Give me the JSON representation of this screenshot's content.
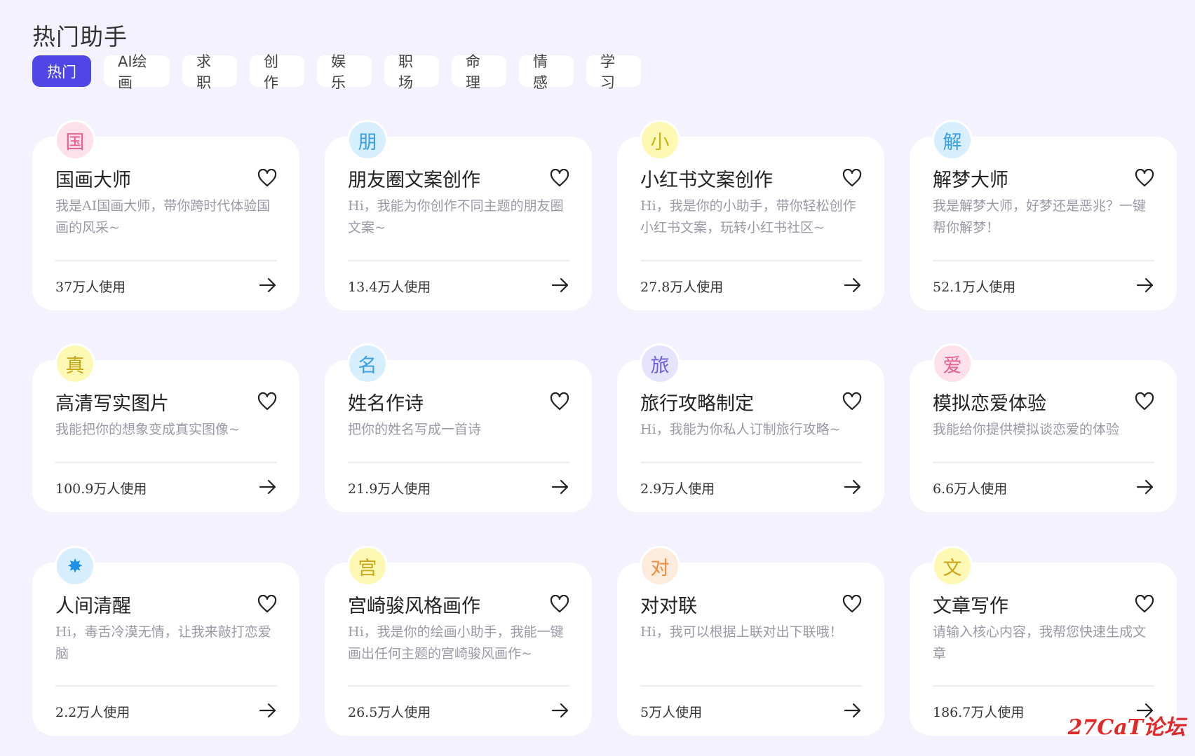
{
  "page_title": "热门助手",
  "tabs": [
    {
      "label": "热门",
      "active": true
    },
    {
      "label": "AI绘画"
    },
    {
      "label": "求职"
    },
    {
      "label": "创作"
    },
    {
      "label": "娱乐"
    },
    {
      "label": "职场"
    },
    {
      "label": "命理"
    },
    {
      "label": "情感"
    },
    {
      "label": "学习"
    }
  ],
  "assistants": [
    {
      "avatar": "国",
      "avatar_bg": "#fde0ea",
      "avatar_color": "#e75f8a",
      "title": "国画大师",
      "desc": "我是AI国画大师，带你跨时代体验国画的风采~",
      "usage": "37万人使用"
    },
    {
      "avatar": "朋",
      "avatar_bg": "#d7eefe",
      "avatar_color": "#3b9fe0",
      "title": "朋友圈文案创作",
      "desc": "Hi，我能为你创作不同主题的朋友圈文案~",
      "usage": "13.4万人使用"
    },
    {
      "avatar": "小",
      "avatar_bg": "#fdf8b4",
      "avatar_color": "#c9b21a",
      "title": "小红书文案创作",
      "desc": "Hi，我是你的小助手，带你轻松创作小红书文案，玩转小红书社区~",
      "usage": "27.8万人使用"
    },
    {
      "avatar": "解",
      "avatar_bg": "#d7eefe",
      "avatar_color": "#3b9fe0",
      "title": "解梦大师",
      "desc": "我是解梦大师，好梦还是恶兆？一键帮你解梦！",
      "usage": "52.1万人使用"
    },
    {
      "avatar": "真",
      "avatar_bg": "#fdf8b4",
      "avatar_color": "#c9a51a",
      "title": "高清写实图片",
      "desc": "我能把你的想象变成真实图像~",
      "usage": "100.9万人使用"
    },
    {
      "avatar": "名",
      "avatar_bg": "#d7eefe",
      "avatar_color": "#3b9fe0",
      "title": "姓名作诗",
      "desc": "把你的姓名写成一首诗",
      "usage": "21.9万人使用"
    },
    {
      "avatar": "旅",
      "avatar_bg": "#e6e4fd",
      "avatar_color": "#6b5fe0",
      "title": "旅行攻略制定",
      "desc": "Hi，我能为你私人订制旅行攻略~",
      "usage": "2.9万人使用"
    },
    {
      "avatar": "爱",
      "avatar_bg": "#fde0ea",
      "avatar_color": "#e75f8a",
      "title": "模拟恋爱体验",
      "desc": "我能给你提供模拟谈恋爱的体验",
      "usage": "6.6万人使用"
    },
    {
      "avatar": "✸",
      "avatar_bg": "#d7eefe",
      "avatar_color": "#1e90e8",
      "title": "人间清醒",
      "desc": "Hi，毒舌冷漠无情，让我来敲打恋爱脑",
      "usage": "2.2万人使用"
    },
    {
      "avatar": "宫",
      "avatar_bg": "#fdf8b4",
      "avatar_color": "#c9a51a",
      "title": "宫崎骏风格画作",
      "desc": "Hi，我是你的绘画小助手，我能一键画出任何主题的宫崎骏风画作~",
      "usage": "26.5万人使用"
    },
    {
      "avatar": "对",
      "avatar_bg": "#fdebdc",
      "avatar_color": "#f08a3c",
      "title": "对对联",
      "desc": "Hi，我可以根据上联对出下联哦！",
      "usage": "5万人使用"
    },
    {
      "avatar": "文",
      "avatar_bg": "#fdf8b4",
      "avatar_color": "#c9a51a",
      "title": "文章写作",
      "desc": "请输入核心内容，我帮您快速生成文章",
      "usage": "186.7万人使用"
    }
  ],
  "watermark": "27CaT论坛"
}
